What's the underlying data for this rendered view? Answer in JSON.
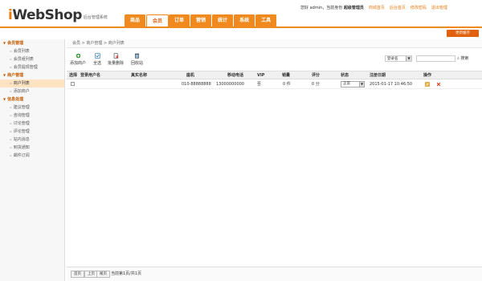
{
  "logo": {
    "main_i": "i",
    "main_rest": "WebShop",
    "sub": "后台管理系统"
  },
  "nav": [
    {
      "label": "商品",
      "active": false
    },
    {
      "label": "会员",
      "active": true
    },
    {
      "label": "订单",
      "active": false
    },
    {
      "label": "营销",
      "active": false
    },
    {
      "label": "统计",
      "active": false
    },
    {
      "label": "系统",
      "active": false
    },
    {
      "label": "工具",
      "active": false
    }
  ],
  "userbar": {
    "greeting": "您好 admin，当前身份",
    "role": "超级管理员",
    "links": [
      "商城首页",
      "后台首页",
      "修改密码",
      "退出管理"
    ]
  },
  "header_button": "更新缓存",
  "sidebar": {
    "groups": [
      {
        "label": "会员管理",
        "items": [
          "会员列表",
          "会员组列表",
          "会员提现管理"
        ]
      },
      {
        "label": "商户管理",
        "items": [
          "商户列表",
          "添加商户"
        ]
      },
      {
        "label": "信息处理",
        "items": [
          "建议管理",
          "咨询管理",
          "讨论管理",
          "评论管理",
          "站内消息",
          "到货通知",
          "邮件订阅"
        ]
      }
    ],
    "active_item": "商户列表"
  },
  "breadcrumb": "会员 > 商户管理 > 商户列表",
  "toolbar": {
    "buttons": [
      "添加商户",
      "全选",
      "批量删除",
      "回收站"
    ],
    "search_select": "登录名",
    "search_input": "",
    "search_button": "搜索"
  },
  "table": {
    "headers": [
      "选择",
      "登录用户名",
      "真实名称",
      "座机",
      "移动电话",
      "VIP",
      "销量",
      "评分",
      "状态",
      "注册日期",
      "操作"
    ],
    "rows": [
      {
        "login": "",
        "realname": "",
        "phone": "010-88888888",
        "mobile": "13000000000",
        "vip": "否",
        "sales": "0 件",
        "score": "0 分",
        "status": "正常",
        "date": "2015-01-17 10:46:50"
      }
    ]
  },
  "pager": {
    "first": "首页",
    "prev": "上页",
    "next": "尾页",
    "info": "当前第1页/共1页"
  },
  "colors": {
    "accent": "#f08a1f",
    "accent_dark": "#e0620e"
  }
}
